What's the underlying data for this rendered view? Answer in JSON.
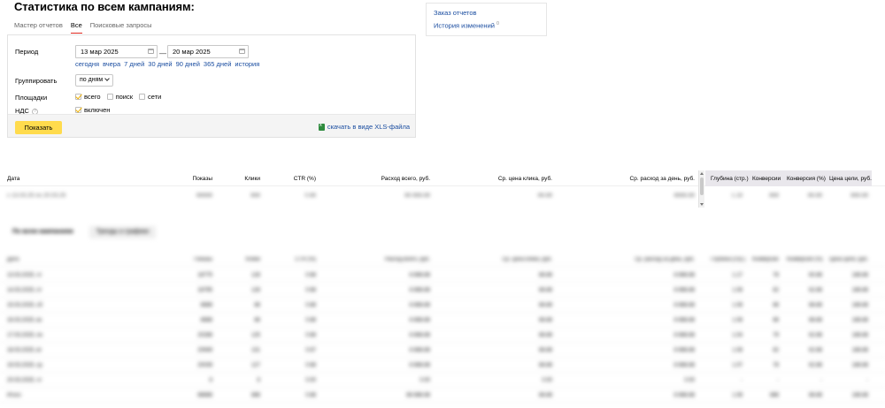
{
  "page": {
    "title": "Статистика по всем кампаниям:"
  },
  "tabs": [
    {
      "label": "Мастер отчетов",
      "active": false
    },
    {
      "label": "Все",
      "active": true
    },
    {
      "label": "Поисковые запросы",
      "active": false
    }
  ],
  "links_box": {
    "order_reports": "Заказ отчетов",
    "history": "История изменений",
    "history_badge": "0"
  },
  "filters": {
    "period_label": "Период",
    "date_from": "13 мар 2025",
    "date_to": "20 мар 2025",
    "dash": "—",
    "quick_periods": [
      "сегодня",
      "вчера",
      "7 дней",
      "30 дней",
      "90 дней",
      "365 дней",
      "история"
    ],
    "group_label": "Группировать",
    "group_value": "по дням",
    "platforms_label": "Площадки",
    "platforms": [
      {
        "label": "всего",
        "checked": true
      },
      {
        "label": "поиск",
        "checked": false
      },
      {
        "label": "сети",
        "checked": false
      }
    ],
    "vat_label": "НДС",
    "vat_help": "?",
    "vat_option": {
      "label": "включен",
      "checked": true
    },
    "show_button": "Показать",
    "xls_link": "скачать в виде XLS-файла"
  },
  "summary_table": {
    "columns": [
      "Дата",
      "Показы",
      "Клики",
      "CTR (%)",
      "Расход всего, руб.",
      "Ср. цена клика, руб.",
      "Ср. расход за день, руб.",
      "Глубина (стр.)",
      "Конверсии",
      "Конверсия (%)",
      "Цена цели, руб."
    ],
    "row": [
      "c 13.03.25 по 20.03.25",
      "88888",
      "888",
      "0.88",
      "88 888.88",
      "88.88",
      "8888.88",
      "1.18",
      "888",
      "88.88",
      "888.88"
    ]
  },
  "sub_tabs": [
    {
      "label": "По всем кампаниям",
      "active": true
    },
    {
      "label": "Тренды и графики",
      "active": false
    }
  ],
  "detail_table": {
    "columns": [
      "Дата",
      "Показы",
      "Клики",
      "CTR (%)",
      "Расход всего, руб.",
      "Ср. цена клика, руб.",
      "Ср. расход за день, руб.",
      "Глубина (стр.)",
      "Конверсии",
      "Конверсия (%)",
      "Цена цели, руб."
    ],
    "rows": [
      [
        "13.03.2025, чт",
        "18775",
        "128",
        "0.68",
        "8 888.88",
        "88.88",
        "8 888.88",
        "1.17",
        "78",
        "60.88",
        "188.88"
      ],
      [
        "14.03.2025, пт",
        "18795",
        "128",
        "0.68",
        "8 888.88",
        "88.88",
        "8 888.88",
        "1.08",
        "82",
        "62.88",
        "188.88"
      ],
      [
        "15.03.2025, сб",
        "8888",
        "88",
        "0.88",
        "8 888.88",
        "88.88",
        "8 888.88",
        "1.08",
        "88",
        "88.88",
        "188.88"
      ],
      [
        "16.03.2025, вс",
        "8888",
        "88",
        "0.88",
        "8 888.88",
        "88.88",
        "8 888.88",
        "1.08",
        "88",
        "88.88",
        "188.88"
      ],
      [
        "17.03.2025, пн",
        "20288",
        "125",
        "0.68",
        "8 888.88",
        "88.88",
        "8 888.88",
        "1.04",
        "79",
        "62.88",
        "188.88"
      ],
      [
        "18.03.2025, вт",
        "20949",
        "131",
        "0.67",
        "8 888.88",
        "88.88",
        "8 888.88",
        "1.08",
        "82",
        "62.88",
        "188.88"
      ],
      [
        "19.03.2025, ср",
        "20039",
        "127",
        "0.68",
        "8 888.88",
        "88.88",
        "8 888.88",
        "1.07",
        "78",
        "62.88",
        "188.88"
      ],
      [
        "20.03.2025, чт",
        "8",
        "8",
        "0.00",
        "0.00",
        "0.00",
        "0.00",
        "-",
        "-",
        "-",
        "-"
      ],
      [
        "Итого",
        "88888",
        "888",
        "0.88",
        "88 888.88",
        "88.88",
        "8 888.88",
        "1.08",
        "888",
        "88.88",
        "188.88"
      ]
    ]
  },
  "colors": {
    "accent_yellow": "#ffdb4d",
    "link_blue": "#1a4da0",
    "active_tab_underline": "#e0281f",
    "header_shade": "#e9e7ec"
  }
}
